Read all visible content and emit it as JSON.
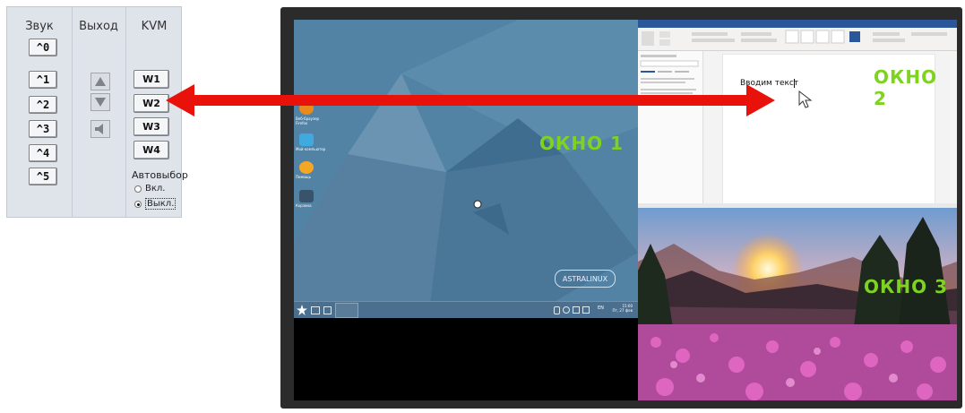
{
  "panel": {
    "sound_header": "Звук",
    "exit_header": "Выход",
    "kvm_header": "KVM",
    "sound_buttons": [
      "^0",
      "^1",
      "^2",
      "^3",
      "^4",
      "^5"
    ],
    "kvm_buttons": [
      "W1",
      "W2",
      "W3",
      "W4"
    ],
    "auto_select_label": "Автовыбор",
    "radio_on_label": "Вкл.",
    "radio_off_label": "Выкл.",
    "selected_radio": "Выкл."
  },
  "monitor": {
    "window1_label": "ОКНО 1",
    "window2_label": "ОКНО 2",
    "window3_label": "ОКНО 3",
    "astra_logo": "ASTRALINUX",
    "document_text": "Вводим текст",
    "clock_time": "15:00",
    "clock_date": "Пт, 27 фев",
    "keyboard_layout": "EN",
    "desktop_icons": [
      "Веб-браузер Firefox",
      "Мой компьютер",
      "Помощь",
      "Корзина"
    ]
  },
  "colors": {
    "arrow": "#e8120b",
    "window_label": "#7ed321",
    "desktop_bg": "#4f7fa0",
    "word_blue": "#2b579a"
  }
}
